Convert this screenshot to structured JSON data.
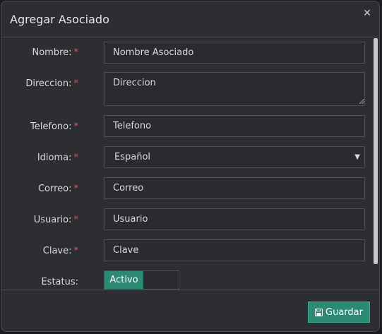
{
  "modal": {
    "title": "Agregar Asociado",
    "close_icon": "close-icon"
  },
  "form": {
    "required_mark": "*",
    "nombre": {
      "label": "Nombre:",
      "placeholder": "Nombre Asociado"
    },
    "direccion": {
      "label": "Direccion:",
      "placeholder": "Direccion"
    },
    "telefono": {
      "label": "Telefono:",
      "placeholder": "Telefono"
    },
    "idioma": {
      "label": "Idioma:",
      "selected": "Español"
    },
    "correo": {
      "label": "Correo:",
      "placeholder": "Correo"
    },
    "usuario": {
      "label": "Usuario:",
      "placeholder": "Usuario"
    },
    "clave": {
      "label": "Clave:",
      "placeholder": "Clave"
    },
    "estatus": {
      "label": "Estatus:",
      "toggle_label": "Activo",
      "active": true
    }
  },
  "footer": {
    "save_label": "Guardar",
    "save_icon": "floppy-disk-icon"
  },
  "colors": {
    "accent": "#2b8a73",
    "required": "#d9534f",
    "background": "#2d2e32"
  }
}
